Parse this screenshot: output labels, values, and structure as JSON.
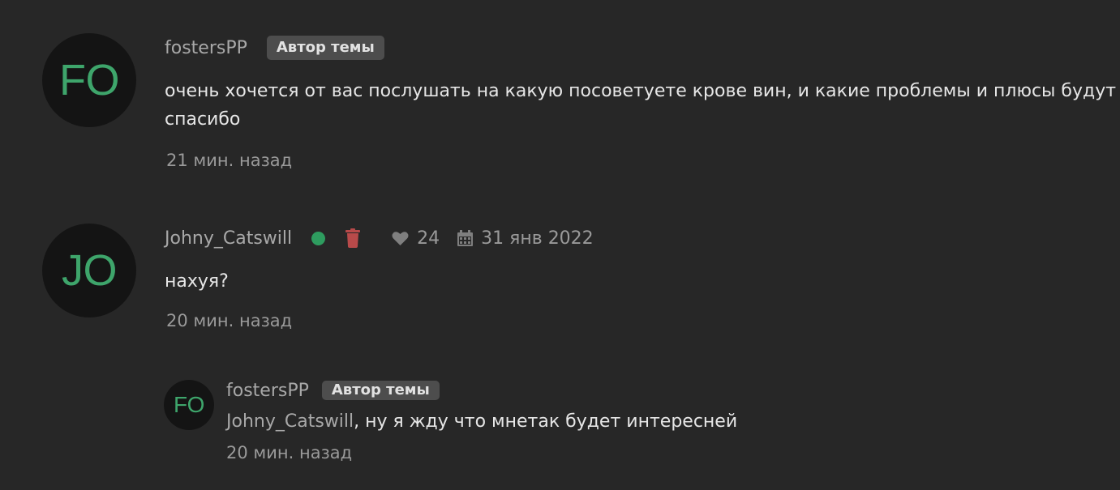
{
  "colors": {
    "background": "#272727",
    "avatar_text": "#3ea56b",
    "online": "#2e9c5f",
    "delete": "#b84a4a"
  },
  "comments": [
    {
      "avatar": "FO",
      "username": "fostersPP",
      "badge": "Автор темы",
      "lines": [
        "очень хочется от вас послушать на какую посоветуете крове вин, и какие проблемы и плюсы будут",
        "спасибо"
      ],
      "time": "21 мин. назад"
    },
    {
      "avatar": "JO",
      "username": "Johny_Catswill",
      "online_icon": "online-dot-icon",
      "delete_icon": "trash-icon",
      "likes": "24",
      "like_icon": "heart-icon",
      "date": "31 янв 2022",
      "date_icon": "calendar-icon",
      "lines": [
        "нахуя?"
      ],
      "time": "20 мин. назад"
    },
    {
      "avatar": "FO",
      "username": "fostersPP",
      "badge": "Автор темы",
      "mention": "Johny_Catswill",
      "text": ", ну я жду что мнетак будет интересней",
      "time": "20 мин. назад"
    }
  ]
}
